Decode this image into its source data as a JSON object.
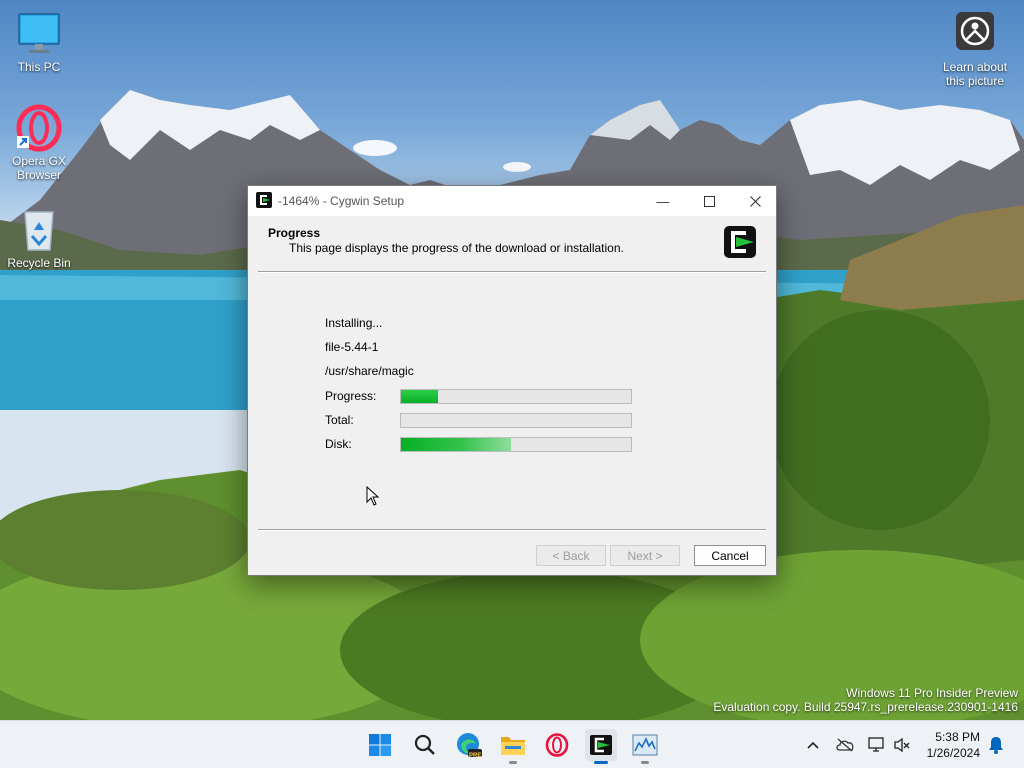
{
  "desktop": {
    "icons": [
      {
        "label": "This PC"
      },
      {
        "label": "Opera GX\nBrowser"
      },
      {
        "label": "Recycle Bin"
      },
      {
        "label": "Learn about\nthis picture"
      }
    ],
    "watermark": {
      "line1": "Windows 11 Pro Insider Preview",
      "line2": "Evaluation copy. Build 25947.rs_prerelease.230901-1416"
    }
  },
  "dialog": {
    "title": "-1464% - Cygwin Setup",
    "header_title": "Progress",
    "header_subtitle": "This page displays the progress of the download or installation.",
    "status": "Installing...",
    "package": "file-5.44-1",
    "path": "/usr/share/magic",
    "progress_label": "Progress:",
    "total_label": "Total:",
    "disk_label": "Disk:",
    "progress_value": 16,
    "total_value": 0,
    "disk_value": 48,
    "back_label": "< Back",
    "next_label": "Next >",
    "cancel_label": "Cancel"
  },
  "taskbar": {
    "time": "5:38 PM",
    "date": "1/26/2024",
    "edge_badge": "PRE"
  },
  "colors": {
    "progress_green": "#06b025",
    "accent": "#0067c0"
  }
}
